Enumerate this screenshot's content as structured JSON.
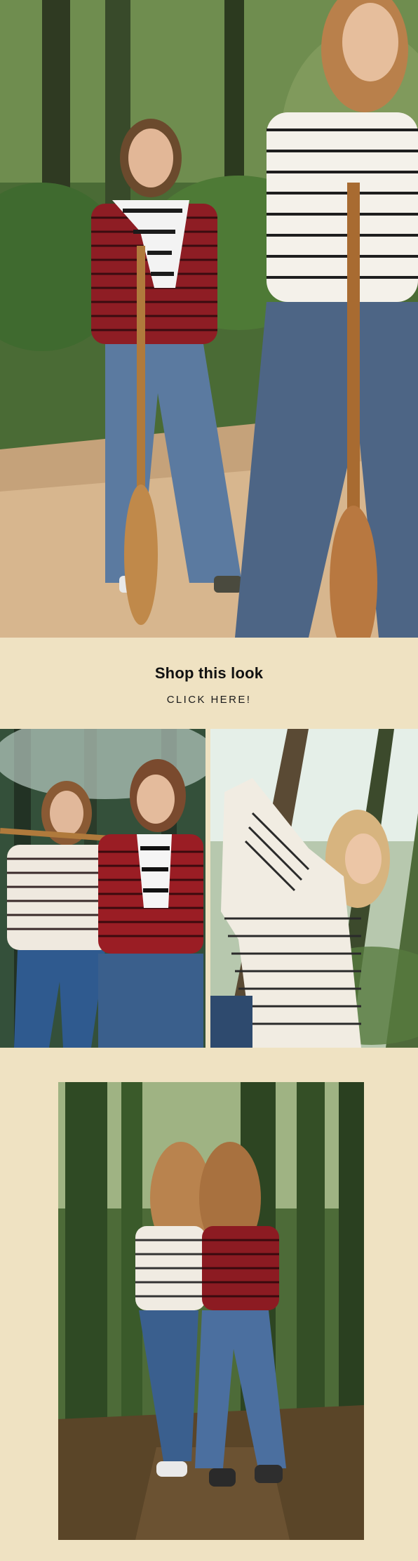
{
  "cta": {
    "title": "Shop this look",
    "link_label": "CLICK HERE!"
  },
  "images": {
    "hero_alt": "",
    "duo_left_alt": "",
    "duo_right_alt": "",
    "bottom_alt": ""
  },
  "colors": {
    "background": "#efe2c2",
    "text": "#111111"
  }
}
